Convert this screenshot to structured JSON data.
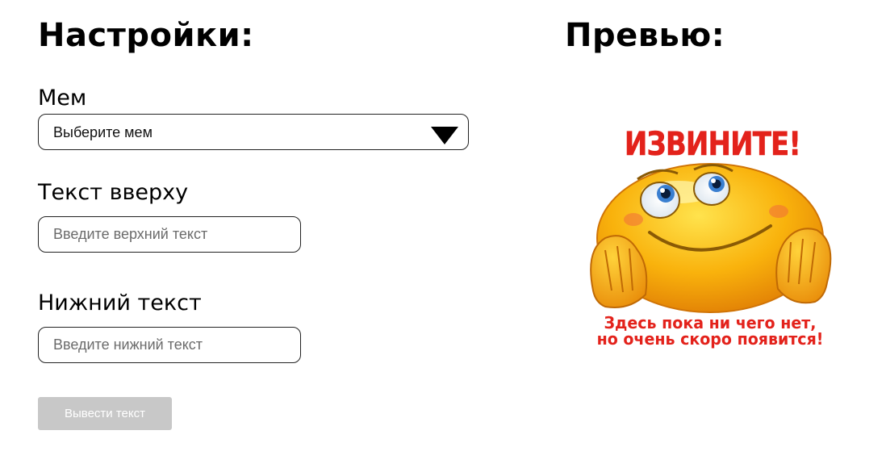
{
  "settings": {
    "heading": "Настройки:",
    "meme_label": "Мем",
    "meme_select_value": "Выберите мем",
    "top_text_label": "Текст вверху",
    "top_text_placeholder": "Введите верхний текст",
    "bottom_text_label": "Нижний текст",
    "bottom_text_placeholder": "Введите нижний текст",
    "submit_label": "Вывести текст"
  },
  "preview": {
    "heading": "Превью:",
    "image": {
      "top_text": "ИЗВИНИТЕ!",
      "bottom_line_1": "Здесь пока ни чего нет,",
      "bottom_line_2": "но очень скоро появится!",
      "icon": "smiley-emoji"
    }
  },
  "colors": {
    "meme_text": "#e3221b",
    "button_disabled_bg": "#c8c8c8",
    "smiley_yellow": "#f9b20c"
  }
}
